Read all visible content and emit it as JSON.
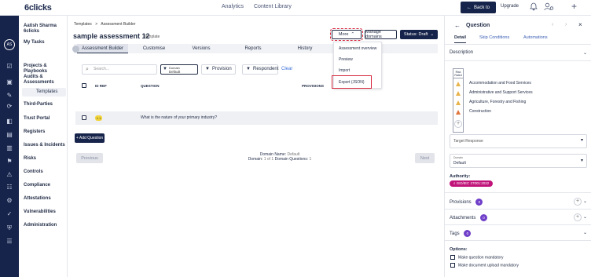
{
  "app": {
    "logo": "6clicks"
  },
  "topbar": {
    "nav": [
      "Analytics",
      "Content Library"
    ],
    "back_label": "Back to",
    "upgrade_label": "Upgrade"
  },
  "user": {
    "initials": "AS",
    "name": "Aatish Sharma",
    "org": "6clicks"
  },
  "nav": {
    "my_tasks": "My Tasks",
    "projects": "Projects & Playbooks",
    "audits": "Audits & Assessments",
    "templates": "Templates",
    "third_parties": "Third-Parties",
    "trust_portal": "Trust Portal",
    "registers": "Registers",
    "issues": "Issues & Incidents",
    "risks": "Risks",
    "controls": "Controls",
    "compliance": "Compliance",
    "attestations": "Attestations",
    "vulnerabilities": "Vulnerabilities",
    "administration": "Administration"
  },
  "breadcrumb": {
    "root": "Templates",
    "sep": ">",
    "current": "Assessment Builder"
  },
  "page": {
    "title": "sample assessment 12",
    "type_label": "Template"
  },
  "header_buttons": {
    "more": "More",
    "manage_domains": "Manage domains",
    "status": "Status: Draft"
  },
  "tabs": [
    "Assessment Builder",
    "Customise",
    "Versions",
    "Reports",
    "History"
  ],
  "filters": {
    "search_placeholder": "Search...",
    "domain_label": "Domain",
    "domain_value": "Default",
    "provision": "Provision",
    "respondent": "Respondent",
    "clear": "Clear"
  },
  "table": {
    "columns": [
      "ID REF",
      "QUESTION",
      "PROVISIONS"
    ],
    "rows": [
      {
        "id": "1.1",
        "question": "What is the nature of your primary industry?",
        "provisions": ""
      }
    ]
  },
  "add_question": "+ Add Question",
  "pagination": {
    "previous": "Previous",
    "next": "Next",
    "domain_name_label": "Domain Name:",
    "domain_name_value": "Default",
    "domain_label": "Domain:",
    "domain_value": "1 of 1",
    "domain_questions_label": "Domain Questions:",
    "domain_questions_value": "1"
  },
  "more_menu": [
    "Assessment overview",
    "Preview",
    "Import",
    "Export (JSON)"
  ],
  "panel": {
    "title": "Question",
    "tabs": [
      "Detail",
      "Skip Conditions",
      "Automations"
    ],
    "description_label": "Description",
    "risk_header": "Risk Rated",
    "risk_options": [
      "Accommodation and Food Services",
      "Administrative and Support Services",
      "Agriculture, Forestry and Fishing",
      "Construction"
    ],
    "target_response_label": "Target Response",
    "domain_label": "Domain",
    "domain_value": "Default",
    "authority_label": "Authority:",
    "authority_value": "ISO/IEC 27001:2022",
    "provisions_label": "Provisions",
    "provisions_count": "0",
    "attachments_label": "Attachments",
    "attachments_count": "0",
    "tags_label": "Tags",
    "tags_count": "0",
    "options_label": "Options:",
    "options": [
      "Make question mandatory",
      "Make document upload mandatory"
    ]
  },
  "colors": {
    "navy": "#16234a",
    "highlight_red": "#d7263d",
    "badge_purple": "#6f3fc9",
    "authority_pink": "#c0147a",
    "id_badge": "#f2d53c"
  }
}
